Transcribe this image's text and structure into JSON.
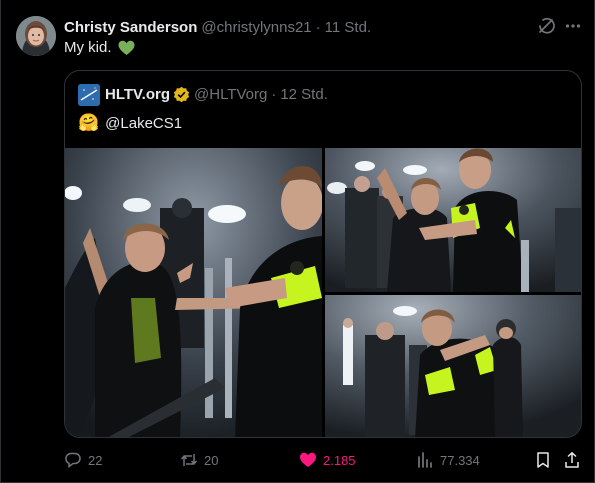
{
  "tweet": {
    "author_name": "Christy Sanderson",
    "author_handle": "@christylynns21",
    "separator": "·",
    "time": "11 Std.",
    "text": "My kid.",
    "emoji_icon": "green-heart-icon"
  },
  "quote": {
    "name": "HLTV.org",
    "handle": "@HLTVorg",
    "separator": "·",
    "time": "12 Std.",
    "emoji": "🤗",
    "mention": "@LakeCS1",
    "photos": [
      "photo-1",
      "photo-2",
      "photo-3"
    ]
  },
  "actions": {
    "replies": "22",
    "retweets": "20",
    "likes": "2.185",
    "views": "77.334"
  },
  "colors": {
    "background": "#000000",
    "text": "#e7e9ea",
    "muted": "#71767b",
    "like": "#f91880",
    "verified": "#e2b719",
    "jersey_green": "#c6f41f",
    "border": "#2f3336"
  },
  "icons": [
    "grok-icon",
    "more-icon",
    "verified-gold-icon",
    "reply-icon",
    "retweet-icon",
    "like-icon",
    "views-icon",
    "bookmark-icon",
    "share-icon"
  ]
}
